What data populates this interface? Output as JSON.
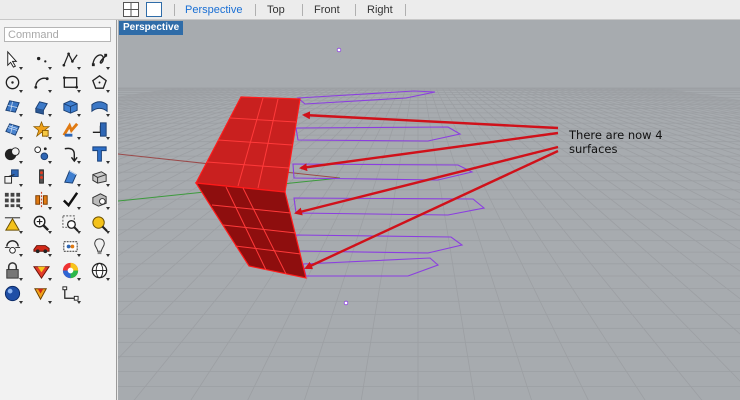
{
  "command": {
    "placeholder": "Command"
  },
  "viewtabs": [
    {
      "label": "Perspective",
      "active": true
    },
    {
      "label": "Top",
      "active": false
    },
    {
      "label": "Front",
      "active": false
    },
    {
      "label": "Right",
      "active": false
    }
  ],
  "viewport": {
    "label": "Perspective"
  },
  "annotation": {
    "text": "There are now 4 surfaces"
  },
  "colors": {
    "accent": "#1a6fd4",
    "surface": "#c9201f",
    "curves": "#8b3ee0",
    "viewport_bg": "#a7abaf",
    "arrow": "#d0111a"
  },
  "tools": [
    "select-icon",
    "point-icon",
    "polyline-icon",
    "curve-icon",
    "circle-icon",
    "arc-icon",
    "rectangle-icon",
    "polygon-icon",
    "surface-icon",
    "extrude-icon",
    "solid-box-icon",
    "solid-tools-icon",
    "mesh-icon",
    "explode-icon",
    "join-icon",
    "trim-icon",
    "boolean-icon",
    "fillet-icon",
    "split-icon",
    "text-icon",
    "group-icon",
    "move-icon",
    "rotate-icon",
    "scale-icon",
    "array-icon",
    "mirror-icon",
    "check-icon",
    "snap-icon",
    "dimension-icon",
    "zoom-icon",
    "zoom-window-icon",
    "render-icon",
    "car-icon",
    "drawing-icon",
    "light-icon",
    "bulb-icon",
    "lock-icon",
    "material-icon",
    "color-wheel-icon",
    "sphere-grid-icon",
    "globe-icon",
    "cursor-icon",
    "layout-icon"
  ]
}
